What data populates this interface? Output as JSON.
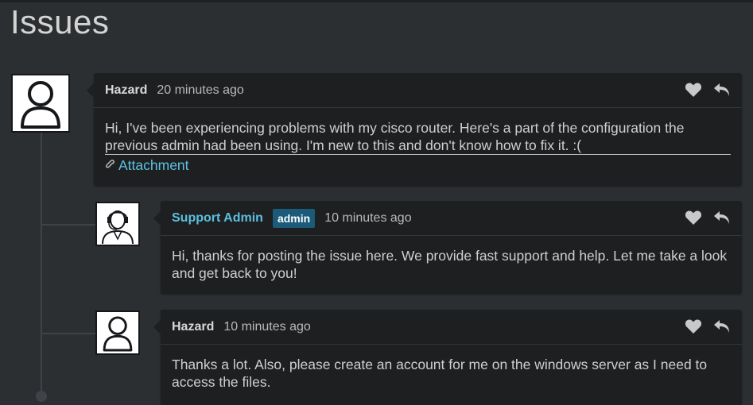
{
  "page": {
    "title": "Issues"
  },
  "comments": [
    {
      "author": "Hazard",
      "time": "20 minutes ago",
      "body_line1": "Hi, I've been experiencing problems with my cisco router. Here's a part of the configuration the",
      "body_line2": "previous admin had been using. I'm new to this and don't know how to fix it. :(",
      "attachment": "Attachment",
      "avatar_icon": "user-icon"
    },
    {
      "author": "Support Admin",
      "badge": "admin",
      "time": "10 minutes ago",
      "body": "Hi, thanks for posting the issue here. We provide fast support and help. Let me take a look and get back to you!",
      "avatar_icon": "support-agent-icon"
    },
    {
      "author": "Hazard",
      "time": "10 minutes ago",
      "body": "Thanks a lot. Also, please create an account for me on the windows server as I need to access the files.",
      "avatar_icon": "user-icon"
    }
  ],
  "colors": {
    "background": "#2c2f32",
    "card": "#1d1f21",
    "link": "#5bc0de",
    "badge": "#1b5a78"
  }
}
